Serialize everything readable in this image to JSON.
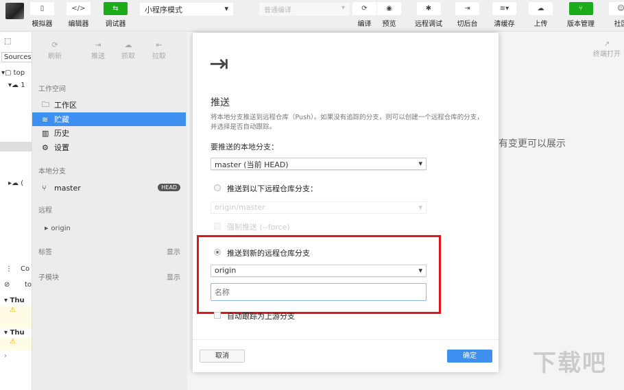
{
  "toolbar": {
    "left": [
      {
        "label": "模拟器",
        "icon": "phone-icon"
      },
      {
        "label": "编辑器",
        "icon": "code-icon"
      },
      {
        "label": "调试器",
        "icon": "debug-icon"
      }
    ],
    "mode": "小程序模式",
    "compile": "普通编译",
    "right": [
      {
        "label": "编译",
        "glyph": "⟳"
      },
      {
        "label": "预览",
        "glyph": "◉"
      },
      {
        "label": "远程调试",
        "glyph": "✱"
      },
      {
        "label": "切后台",
        "glyph": "⇥"
      },
      {
        "label": "清缓存",
        "glyph": "≋▾"
      },
      {
        "label": "上传",
        "glyph": "☁"
      },
      {
        "label": "版本管理",
        "glyph": "⑂"
      },
      {
        "label": "社区",
        "glyph": "☺"
      }
    ]
  },
  "devtools": {
    "tab": "Sources",
    "tree": [
      "top",
      "1",
      "(",
      "Co",
      "to",
      "Thu",
      "Thu"
    ]
  },
  "git": {
    "actions": [
      "刷新",
      "推送",
      "抓取",
      "拉取"
    ],
    "workspace_title": "工作空间",
    "workspace": [
      "工作区",
      "贮藏",
      "历史",
      "设置"
    ],
    "local_title": "本地分支",
    "branch": "master",
    "head": "HEAD",
    "remote_title": "远程",
    "remote": "origin",
    "tags": "标签",
    "submodules": "子模块",
    "show": "显示"
  },
  "dialog": {
    "title": "推送",
    "desc": "将本地分支推送到远程仓库（Push）。如果没有追踪的分支，则可以创建一个远程仓库的分支，并选择是否自动跟踪。",
    "local_label": "要推送的本地分支：",
    "local_value": "master (当前 HEAD)",
    "opt1": "推送到以下远程仓库分支：",
    "opt1_value": "origin/master",
    "force": "强制推送 (--force)",
    "opt2": "推送到新的远程仓库分支",
    "opt2_value": "origin",
    "name_placeholder": "名称",
    "track": "自动跟踪为上游分支",
    "cancel": "取消",
    "ok": "确定"
  },
  "right": {
    "terminal": "终端打开",
    "empty": "有变更可以展示"
  },
  "colors": {
    "accent": "#3d8ff0",
    "green": "#1aad19",
    "highlight": "#e0141e"
  }
}
